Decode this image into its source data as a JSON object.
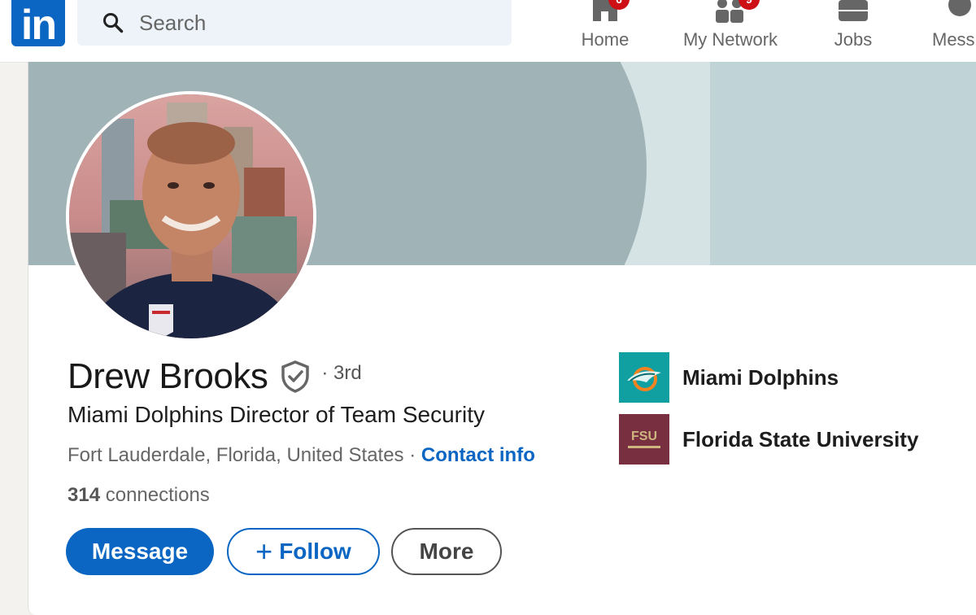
{
  "nav": {
    "search_placeholder": "Search",
    "items": [
      {
        "label": "Home",
        "badge": "6"
      },
      {
        "label": "My Network",
        "badge": "9"
      },
      {
        "label": "Jobs"
      },
      {
        "label": "Mess"
      }
    ]
  },
  "profile": {
    "name": "Drew Brooks",
    "degree": "· 3rd",
    "headline": "Miami Dolphins Director of Team Security",
    "location": "Fort Lauderdale, Florida, United States",
    "separator": " · ",
    "contact_info": "Contact info",
    "connections_count": "314",
    "connections_label": "connections"
  },
  "actions": {
    "message": "Message",
    "follow": "Follow",
    "follow_icon": "+",
    "more": "More"
  },
  "orgs": [
    {
      "name": "Miami Dolphins",
      "logo_color": "#11a0a1",
      "icon": "dolphins-logo"
    },
    {
      "name": "Florida State University",
      "logo_color": "#782f40",
      "logo_text": "FSU",
      "icon": "fsu-logo"
    }
  ],
  "colors": {
    "brand": "#0a66c2",
    "badge": "#cc1016"
  }
}
